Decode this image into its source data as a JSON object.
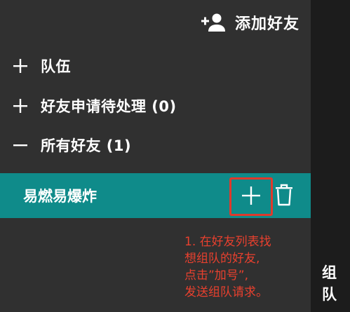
{
  "header": {
    "add_friend_label": "添加好友",
    "add_friend_icon": "add-person-icon"
  },
  "sections": [
    {
      "sign": "+",
      "label": "队伍",
      "expanded": false
    },
    {
      "sign": "+",
      "label": "好友申请待处理 (0)",
      "expanded": false
    },
    {
      "sign": "−",
      "label": "所有好友 (1)",
      "expanded": true
    }
  ],
  "friends": [
    {
      "name": "易燃易爆炸",
      "actions": [
        "plus-icon",
        "trash-icon"
      ]
    }
  ],
  "annotation": {
    "lines": [
      "1. 在好友列表找",
      "想组队的好友,",
      "点击”加号”,",
      "发送组队请求。"
    ],
    "color": "#e8402e"
  },
  "side_label": {
    "chars": [
      "组",
      "队"
    ]
  },
  "colors": {
    "panel_bg": "#303030",
    "selected_row_bg": "#0f8b8a",
    "highlight_border": "#e0392b",
    "text": "#ffffff"
  }
}
